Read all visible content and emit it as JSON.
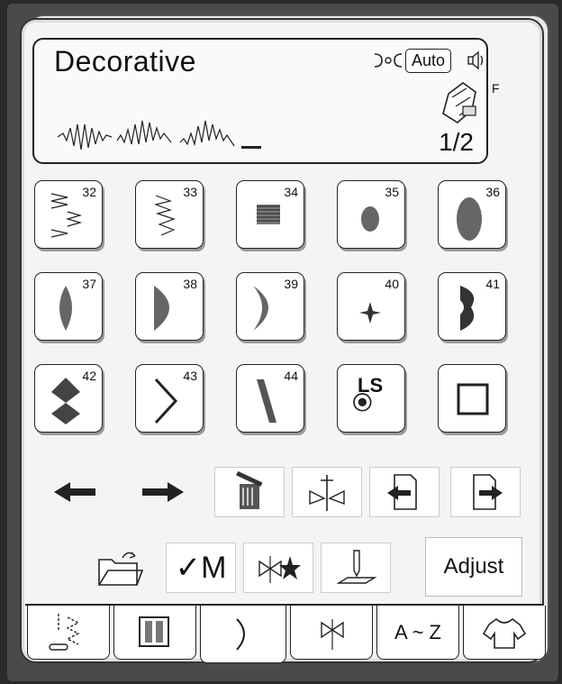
{
  "header": {
    "title": "Decorative",
    "auto_label": "Auto",
    "foot_label": "F",
    "page": "1/2",
    "icons": [
      "thread-tension-icon",
      "speaker-icon",
      "presser-foot-icon"
    ]
  },
  "stitches": [
    {
      "num": "32",
      "icon": "zigzag-step-stitch-icon"
    },
    {
      "num": "33",
      "icon": "zigzag-stitch-icon"
    },
    {
      "num": "34",
      "icon": "satin-block-stitch-icon"
    },
    {
      "num": "35",
      "icon": "small-oval-stitch-icon"
    },
    {
      "num": "36",
      "icon": "large-oval-stitch-icon"
    },
    {
      "num": "37",
      "icon": "leaf-stitch-icon"
    },
    {
      "num": "38",
      "icon": "half-moon-stitch-icon"
    },
    {
      "num": "39",
      "icon": "crescent-stitch-icon"
    },
    {
      "num": "40",
      "icon": "star-stitch-icon"
    },
    {
      "num": "41",
      "icon": "double-scallop-stitch-icon"
    },
    {
      "num": "42",
      "icon": "diamond-stitch-icon"
    },
    {
      "num": "43",
      "icon": "chevron-stitch-icon"
    },
    {
      "num": "44",
      "icon": "slanted-satin-stitch-icon"
    },
    {
      "num": "",
      "icon": "ls-lock-stitch-icon",
      "label": "LS"
    },
    {
      "num": "",
      "icon": "square-frame-stitch-icon"
    }
  ],
  "controls": {
    "row1": [
      "arrow-left-icon",
      "arrow-right-icon",
      "trash-icon",
      "mirror-icon",
      "page-back-icon",
      "page-forward-icon"
    ],
    "row2": [
      "folder-save-icon",
      "memory-check-icon",
      "combo-stitch-icon",
      "needle-up-icon"
    ],
    "memory_label": "✓M",
    "adjust_label": "Adjust"
  },
  "tabs": [
    {
      "icon": "utility-stitch-tab-icon"
    },
    {
      "icon": "buttonhole-tab-icon"
    },
    {
      "icon": "decorative-tab-icon",
      "active": true
    },
    {
      "icon": "applique-tab-icon"
    },
    {
      "icon": "alphabet-tab-icon",
      "label": "A ~ Z"
    },
    {
      "icon": "garment-tab-icon"
    }
  ],
  "colors": {
    "outline": "#222222",
    "panel": "#f4f4f4",
    "bezel": "#4a4a4a"
  }
}
